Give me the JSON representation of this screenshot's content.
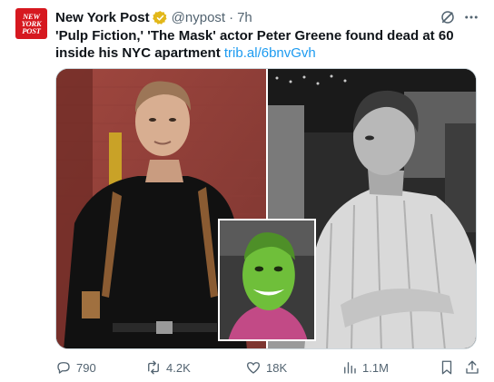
{
  "account": {
    "logo_lines": [
      "NEW",
      "YORK",
      "POST"
    ],
    "display_name": "New York Post",
    "handle": "@nypost",
    "separator": "·",
    "time": "7h",
    "verified_color": "#e2b719",
    "avatar_color": "#d6181f"
  },
  "tweet": {
    "text": "'Pulp Fiction,' 'The Mask' actor Peter Greene found dead at 60 inside his NYC apartment",
    "link": "trib.al/6bnvGvh"
  },
  "media": {
    "left_photo": "portrait-color-photo",
    "right_photo": "black-and-white-photo",
    "inset_photo": "green-mask-photo"
  },
  "actions": {
    "replies": "790",
    "reposts": "4.2K",
    "likes": "18K",
    "views": "1.1M"
  },
  "colors": {
    "text": "#0f1419",
    "muted": "#536471",
    "link": "#1d9bf0"
  }
}
